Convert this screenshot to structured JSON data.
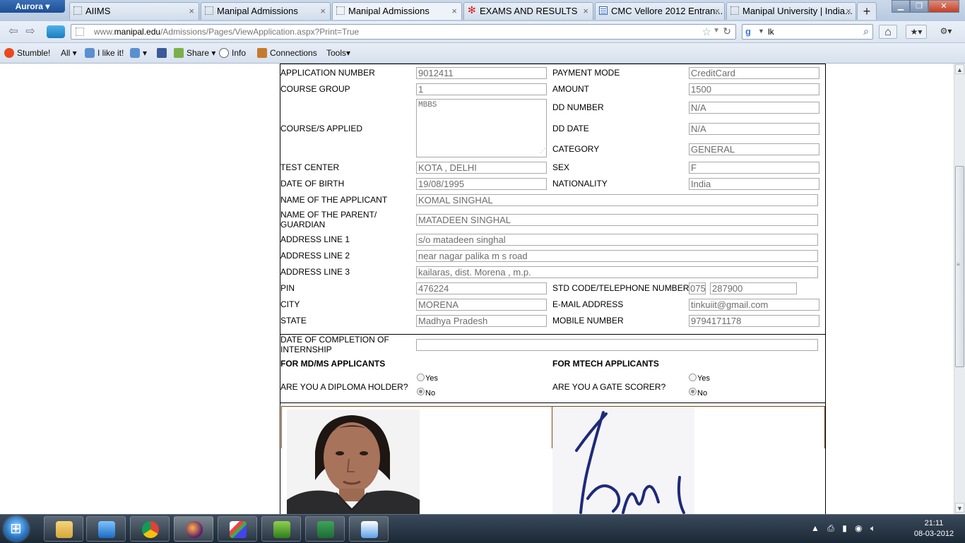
{
  "browser": {
    "app_button": "Aurora",
    "tabs": [
      {
        "title": "AIIMS",
        "icon": "blank-page-icon"
      },
      {
        "title": "Manipal Admissions",
        "icon": "blank-page-icon"
      },
      {
        "title": "Manipal Admissions",
        "icon": "blank-page-icon",
        "active": true
      },
      {
        "title": "EXAMS AND RESULTS",
        "icon": "exams-site-icon"
      },
      {
        "title": "CMC Vellore 2012 Entran...",
        "icon": "cmc-site-icon"
      },
      {
        "title": "Manipal University | India...",
        "icon": "blank-page-icon"
      }
    ],
    "url_prefix": "www.",
    "url_domain": "manipal.edu",
    "url_path": "/Admissions/Pages/ViewApplication.aspx?Print=True",
    "search_query": "lk"
  },
  "toolbar": {
    "stumble": "Stumble!",
    "all": "All",
    "i_like_it": "I like it!",
    "share": "Share",
    "info": "Info",
    "connections": "Connections",
    "tools": "Tools"
  },
  "form": {
    "labels": {
      "application_number": "APPLICATION NUMBER",
      "course_group": "COURSE GROUP",
      "courses_applied": "COURSE/S APPLIED",
      "test_center": "TEST CENTER",
      "dob": "DATE OF BIRTH",
      "applicant_name": "NAME OF THE APPLICANT",
      "parent_line1": "NAME OF THE PARENT/",
      "parent_line2": "GUARDIAN",
      "address1": "ADDRESS LINE 1",
      "address2": "ADDRESS LINE 2",
      "address3": "ADDRESS LINE 3",
      "pin": "PIN",
      "city": "CITY",
      "state": "STATE",
      "payment_mode": "PAYMENT MODE",
      "amount": "AMOUNT",
      "dd_number": "DD NUMBER",
      "dd_date": "DD DATE",
      "category": "CATEGORY",
      "sex": "SEX",
      "nationality": "NATIONALITY",
      "std_tel": "STD CODE/TELEPHONE NUMBER",
      "email": "E-MAIL ADDRESS",
      "mobile": "MOBILE NUMBER",
      "internship_line1": "DATE OF COMPLETION OF",
      "internship_line2": "INTERNSHIP",
      "mdms_heading": "FOR MD/MS APPLICANTS",
      "mtech_heading": "FOR MTECH APPLICANTS",
      "diploma_q": "ARE YOU A DIPLOMA HOLDER?",
      "gate_q": "ARE YOU A GATE SCORER?",
      "yes": "Yes",
      "no": "No"
    },
    "values": {
      "application_number": "9012411",
      "course_group": "1",
      "courses_applied": "MBBS",
      "test_center": "KOTA , DELHI",
      "dob": "19/08/1995",
      "applicant_name": "KOMAL SINGHAL",
      "parent_name": "MATADEEN SINGHAL",
      "address1": "s/o matadeen singhal",
      "address2": "near nagar palika m s road",
      "address3": "kailaras,  dist. Morena , m.p.",
      "pin": "476224",
      "city": "MORENA",
      "state": "Madhya Pradesh",
      "payment_mode": "CreditCard",
      "amount": "1500",
      "dd_number": "N/A",
      "dd_date": "N/A",
      "category": "GENERAL",
      "sex": "F",
      "nationality": "India",
      "std_code": "075",
      "telephone": "287900",
      "email": "tinkuiit@gmail.com",
      "mobile": "9794171178",
      "internship_date": "",
      "diploma_holder": "No",
      "gate_scorer": "No"
    }
  },
  "taskbar": {
    "time": "21:11",
    "date": "08-03-2012"
  }
}
